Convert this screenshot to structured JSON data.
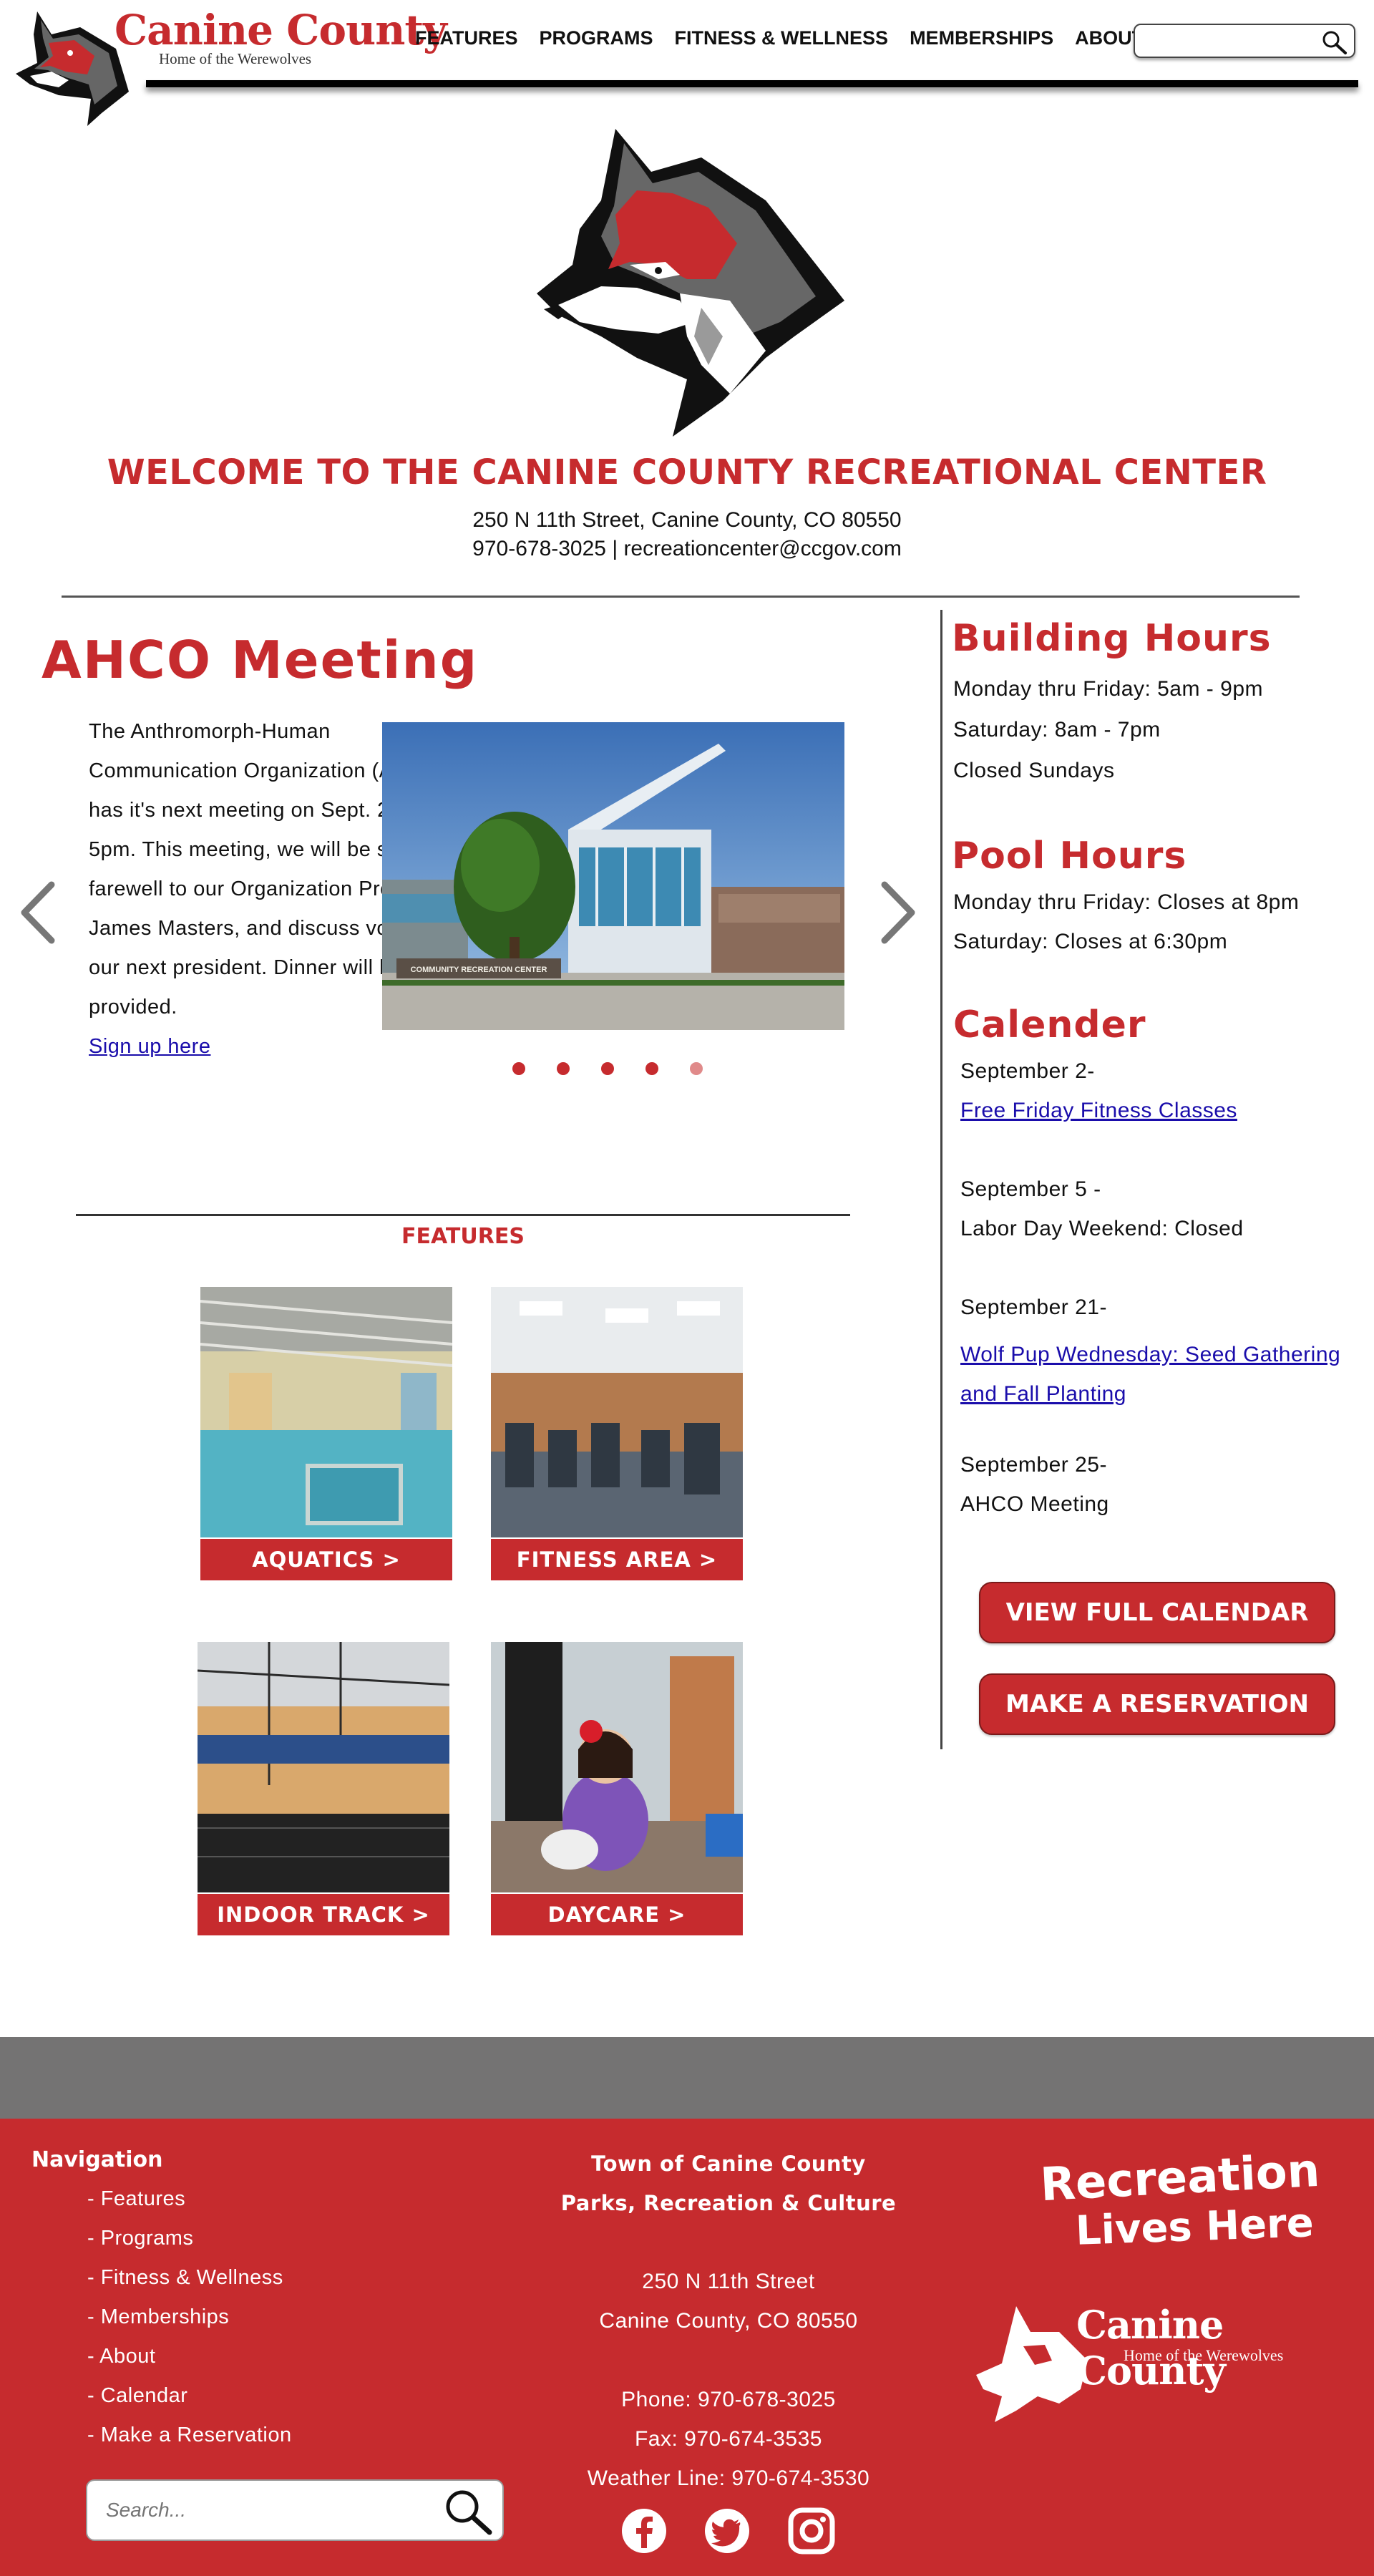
{
  "header": {
    "brand_name": "Canine County",
    "brand_tagline": "Home of the Werewolves",
    "nav": [
      "FEATURES",
      "PROGRAMS",
      "FITNESS & WELLNESS",
      "MEMBERSHIPS",
      "ABOUT"
    ],
    "search_placeholder": ""
  },
  "hero": {
    "title": "WELCOME TO THE CANINE COUNTY RECREATIONAL CENTER",
    "address": "250 N 11th Street, Canine County, CO 80550",
    "contact": "970-678-3025 | recreationcenter@ccgov.com"
  },
  "slider": {
    "title": "AHCO Meeting",
    "body": "The Anthromorph-Human Communication Organization (AHCO) has it's next meeting on Sept. 25 @ 5pm. This meeting, we will be saying farewell to our Organization President, James Masters, and discuss voting for our next president. Dinner will be provided.",
    "link": "Sign up here",
    "image_sign": "COMMUNITY RECREATION CENTER",
    "dot_count": 5,
    "active_dot": 4
  },
  "features": {
    "title": "FEATURES",
    "cards": [
      {
        "label": "AQUATICS >"
      },
      {
        "label": "FITNESS AREA >"
      },
      {
        "label": "INDOOR TRACK >"
      },
      {
        "label": "DAYCARE >"
      }
    ]
  },
  "sidebar": {
    "building_hours": {
      "title": "Building Hours",
      "lines": [
        "Monday thru Friday: 5am - 9pm",
        "Saturday: 8am - 7pm",
        "Closed Sundays"
      ]
    },
    "pool_hours": {
      "title": "Pool Hours",
      "lines": [
        "Monday thru Friday: Closes at 8pm",
        "Saturday: Closes at 6:30pm"
      ]
    },
    "calendar": {
      "title": "Calender",
      "events": [
        {
          "date": "September 2-",
          "name": "Free Friday Fitness Classes",
          "is_link": true
        },
        {
          "date": "September 5 -",
          "name": "Labor Day Weekend: Closed",
          "is_link": false
        },
        {
          "date": "September 21-",
          "name_line1": "Wolf Pup Wednesday: Seed Gathering",
          "name_line2": "and Fall Planting",
          "is_link": true
        },
        {
          "date": "September 25-",
          "name": "AHCO Meeting",
          "is_link": false
        }
      ]
    },
    "buttons": {
      "calendar": "VIEW FULL CALENDAR",
      "reservation": "MAKE A RESERVATION"
    }
  },
  "footer": {
    "nav_title": "Navigation",
    "nav_items": [
      "- Features",
      "- Programs",
      "- Fitness & Wellness",
      "- Memberships",
      "- About",
      "- Calendar",
      "- Make a Reservation"
    ],
    "search_placeholder": "Search...",
    "org_line1": "Town of Canine County",
    "org_line2": "Parks, Recreation & Culture",
    "street": "250 N 11th Street",
    "city": "Canine County, CO 80550",
    "phone": "Phone: 970-678-3025",
    "fax": "Fax: 970-674-3535",
    "weather": "Weather Line: 970-674-3530",
    "slogan_line1": "Recreation",
    "slogan_line2": "Lives Here",
    "brand_name": "Canine County",
    "brand_tagline": "Home of the Werewolves",
    "social_icons": [
      "facebook-icon",
      "twitter-icon",
      "instagram-icon"
    ]
  },
  "colors": {
    "brand_red": "#c62b2e",
    "footer_gray": "#747373",
    "link_blue": "#1a0dab"
  }
}
